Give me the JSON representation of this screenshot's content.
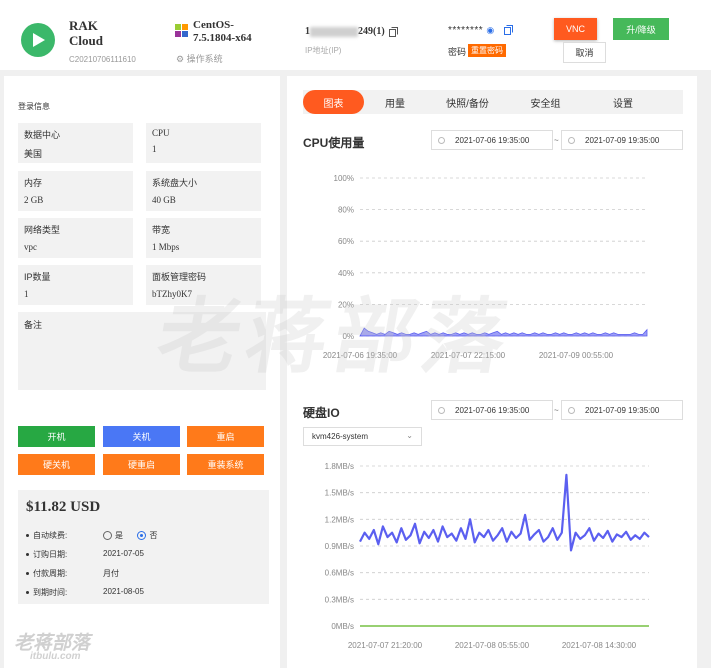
{
  "header": {
    "app_title": "RAK Cloud",
    "app_id": "C20210706111610",
    "os_name": "CentOS-7.5.1804-x64",
    "os_label": "操作系统",
    "ip_prefix": "1",
    "ip_suffix": "249(1)",
    "ip_label": "IP地址(IP)",
    "password_masked": "********",
    "password_label": "密码",
    "reset_password": "重置密码",
    "vnc": "VNC",
    "upgrade": "升/降级",
    "cancel": "取消"
  },
  "left": {
    "login_info": "登录信息",
    "fields": [
      {
        "label": "数据中心",
        "value": "美国"
      },
      {
        "label": "CPU",
        "value": "1"
      },
      {
        "label": "内存",
        "value": "2 GB"
      },
      {
        "label": "系统盘大小",
        "value": "40 GB"
      },
      {
        "label": "网络类型",
        "value": "vpc"
      },
      {
        "label": "带宽",
        "value": "1 Mbps"
      },
      {
        "label": "IP数量",
        "value": "1"
      },
      {
        "label": "面板管理密码",
        "value": "bTZhy0K7"
      }
    ],
    "note_label": "备注",
    "actions": [
      "开机",
      "关机",
      "重启",
      "硬关机",
      "硬重启",
      "重装系统"
    ],
    "price": "$11.82 USD",
    "auto_renew_label": "自动续费:",
    "auto_renew_yes": "是",
    "auto_renew_no": "否",
    "order_date_label": "订购日期:",
    "order_date": "2021-07-05",
    "billing_cycle_label": "付款周期:",
    "billing_cycle": "月付",
    "expire_label": "到期时间:",
    "expire_date": "2021-08-05"
  },
  "tabs": [
    "图表",
    "用量",
    "快照/备份",
    "安全组",
    "设置"
  ],
  "cpu": {
    "title": "CPU使用量",
    "date_from": "2021-07-06 19:35:00",
    "date_sep": "~",
    "date_to": "2021-07-09 19:35:00"
  },
  "disk": {
    "title": "硬盘IO",
    "date_from": "2021-07-06 19:35:00",
    "date_sep": "~",
    "date_to": "2021-07-09 19:35:00",
    "device": "kvm426-system"
  },
  "colors": {
    "accent": "#ff5a1f",
    "line": "#5b5ff0",
    "green": "#3bb86a",
    "zero_line": "#76c043"
  },
  "watermark": {
    "big": "老蒋部落",
    "small": "老蒋部落",
    "url": "itbulu.com"
  },
  "chart_data": [
    {
      "type": "area",
      "title": "CPU使用量",
      "yticks": [
        "100%",
        "80%",
        "60%",
        "40%",
        "20%",
        "0%"
      ],
      "ylim": [
        0,
        100
      ],
      "xticks": [
        "2021-07-06 19:35:00",
        "2021-07-07 22:15:00",
        "2021-07-09 00:55:00"
      ],
      "series": [
        {
          "values": [
            0,
            5,
            3,
            2,
            1,
            2,
            1,
            3,
            2,
            1,
            2,
            1,
            1,
            2,
            1,
            2,
            3,
            1,
            2,
            1,
            2,
            1,
            1,
            2,
            1,
            2,
            1,
            2,
            1,
            1,
            2,
            1,
            2,
            3,
            1,
            2,
            1,
            2,
            1,
            2,
            1,
            1,
            2,
            1,
            2,
            1,
            1,
            2,
            1,
            2,
            1,
            1,
            2,
            1,
            2,
            1,
            2,
            1,
            1,
            2,
            1,
            2,
            1,
            1,
            1,
            1,
            2,
            1,
            1,
            4
          ]
        }
      ]
    },
    {
      "type": "line",
      "title": "硬盘IO",
      "yticks": [
        "1.8MB/s",
        "1.5MB/s",
        "1.2MB/s",
        "0.9MB/s",
        "0.6MB/s",
        "0.3MB/s",
        "0MB/s"
      ],
      "ylim": [
        0,
        1.8
      ],
      "xticks": [
        "2021-07-07 21:20:00",
        "2021-07-08 05:55:00",
        "2021-07-08 14:30:00"
      ],
      "series": [
        {
          "values": [
            0.95,
            1.05,
            0.98,
            1.08,
            0.92,
            1.12,
            1.0,
            1.05,
            0.94,
            1.1,
            0.97,
            1.02,
            1.15,
            0.93,
            1.06,
            0.99,
            1.08,
            0.95,
            1.12,
            1.0,
            1.04,
            0.96,
            1.1,
            0.98,
            1.2,
            0.94,
            1.05,
            1.0,
            1.08,
            0.96,
            1.02,
            1.1,
            0.95,
            1.06,
            0.99,
            1.04,
            1.25,
            0.97,
            1.03,
            1.08,
            0.95,
            1.0,
            1.1,
            0.97,
            1.05,
            1.7,
            0.85,
            1.05,
            0.98,
            1.02,
            1.1,
            0.96,
            1.04,
            0.99,
            1.07,
            0.95,
            1.03,
            1.0,
            1.06,
            0.97,
            1.02,
            0.98,
            1.05,
            1.0
          ]
        },
        {
          "values": [
            0,
            0,
            0,
            0,
            0,
            0,
            0,
            0,
            0,
            0,
            0,
            0
          ]
        }
      ]
    }
  ]
}
